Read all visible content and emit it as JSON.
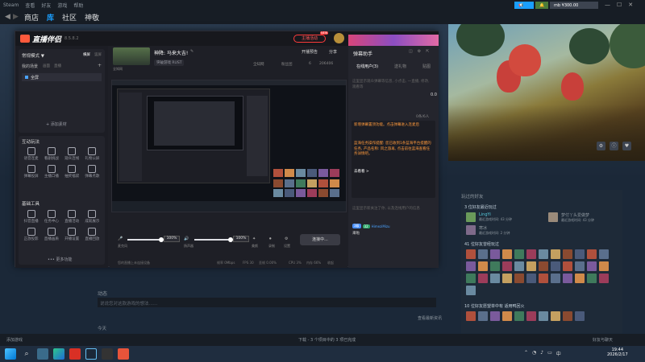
{
  "steam": {
    "menu": [
      "Steam",
      "查看",
      "好友",
      "游戏",
      "帮助"
    ],
    "nav": {
      "store": "商店",
      "library": "库",
      "community": "社区",
      "user": "神敬"
    },
    "wallet": "¥300.00",
    "user_short": "mb",
    "friends_section_title": "玩过的好友",
    "recent_played_header": "3 位好友最近玩过",
    "friends_recent": [
      {
        "name": "LingYi",
        "sub": "最近游戏时间: 43 分钟"
      },
      {
        "name": "寒冰",
        "sub": "最近游戏时间: 2 分钟"
      },
      {
        "name": "梦付丫头爱做梦",
        "sub": "最近游戏时间: 43 分钟"
      }
    ],
    "played_header": "41 位好友曾经玩过",
    "wishlist_header": "10 位好友愿望单中有 适用鸭回火",
    "activity_title": "动态",
    "activity_placeholder": "说说您对这款游戏的想法……",
    "all_news": "查看最新资讯",
    "bottom_label": "今天",
    "status_add_game": "添加游戏",
    "status_downloads": "下载 - 3 个项目中的 3 项已完成",
    "status_friends": "好友与聊天"
  },
  "app": {
    "title": "直播伴侣",
    "version": "8.5.8.2",
    "badge_new": "NEW",
    "title_tag": "主播活动",
    "sidebar": {
      "mode_label": "常规模式 ▼",
      "horizontal": "横屏",
      "vertical": "竖屏",
      "scenes_label": "我的场景",
      "scene_tabs": [
        "画面",
        "直播"
      ],
      "scene_item": "全屏",
      "add_material": "+ 添加素材",
      "interaction_title": "互动玩法",
      "interaction_tools": [
        "语音连麦",
        "看剧挑战",
        "观众连线",
        "礼物公屏",
        "弹幕投屏",
        "主播口播",
        "抽奖福袋",
        "弹幕点歌"
      ],
      "basic_title": "基础工具",
      "basic_tools": [
        "抖音直播",
        "任务中心",
        "直播活动",
        "成就展示",
        "正放投影",
        "直播画质",
        "开播设置",
        "直播回放"
      ],
      "more": "••• 更多功能"
    },
    "stream": {
      "title": "神降: 马来大吉!",
      "category": "突破游戏 RUST",
      "stats": [
        "开播预告",
        "分享"
      ],
      "subtitle": "全知网",
      "fans": "粉丝团",
      "likes": "6",
      "viewers": "206406",
      "mic_label": "麦克风",
      "mic_level": "100%",
      "speaker_label": "扬声器",
      "speaker_level": "100%",
      "effect": "美颜",
      "record": "录制",
      "highlight": "高光",
      "settings": "设置",
      "start_button": "连接中...",
      "footer_status": "您的直播上未连接设备",
      "footer_bitrate": "帧率 0Mbps",
      "footer_fps": "FPS 30",
      "footer_drop": "丢帧 0.00%",
      "footer_cpu": "CPU 3%",
      "footer_mem": "内存 66%",
      "footer_expand": "收起"
    },
    "chat": {
      "title": "弹幕助手",
      "tabs": [
        "在线用户(3)",
        "送礼物",
        "贴图"
      ],
      "hint": "这里显示观众弹幕等信息, 小点击, 一直播, 修改, 观看等",
      "count": "0条/6人",
      "score": "0.0",
      "notice1": "新增弹幕置顶功能。点击弹幕进入连麦后",
      "notice2": "蓝海任务操作提醒: 您已收到1条蓝海平台提醒的任务, 产品名称: 风之旅再, 点击前往蓝海查看任务详情吧。",
      "notice_link": "去看看 >",
      "guide": "这里显示新关注了你, 以及连线用户的信息",
      "user_level": "3级",
      "user_fan": "32",
      "user_name": "HimeziMizu",
      "user_action": "来啦"
    }
  },
  "taskbar": {
    "time": "19:44",
    "date": "2026/2/17",
    "lang": "中"
  }
}
